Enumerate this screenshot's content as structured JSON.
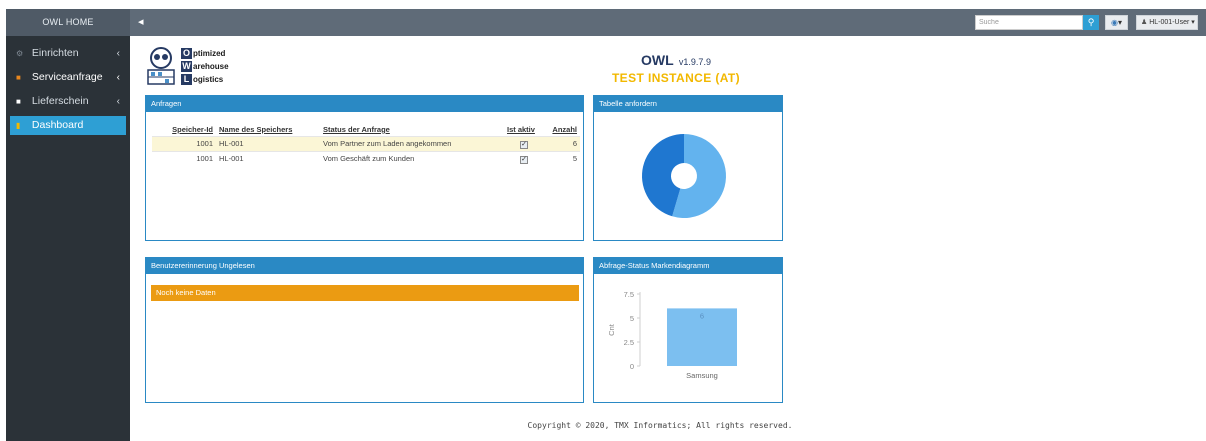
{
  "brand": "OWL HOME",
  "sidebar": {
    "items": [
      {
        "label": "Einrichten",
        "icon": "gear-icon"
      },
      {
        "label": "Serviceanfrage",
        "icon": "inbox-icon"
      },
      {
        "label": "Lieferschein",
        "icon": "file-icon"
      },
      {
        "label": "Dashboard",
        "icon": "bar-chart-icon"
      }
    ]
  },
  "topbar": {
    "search_placeholder": "Suche",
    "user_label": "HL-001-User"
  },
  "logo": {
    "lines": [
      {
        "letter": "O",
        "rest": "ptimized"
      },
      {
        "letter": "W",
        "rest": "arehouse"
      },
      {
        "letter": "L",
        "rest": "ogistics"
      }
    ]
  },
  "header": {
    "app_name": "OWL",
    "version": "v1.9.7.9",
    "instance": "TEST INSTANCE (AT)"
  },
  "requests": {
    "title": "Anfragen",
    "columns": [
      "Speicher-Id",
      "Name des Speichers",
      "Status der Anfrage",
      "Ist aktiv",
      "Anzahl"
    ],
    "rows": [
      {
        "id": "1001",
        "name": "HL-001",
        "status": "Vom Partner zum Laden angekommen",
        "active": true,
        "count": "6"
      },
      {
        "id": "1001",
        "name": "HL-001",
        "status": "Vom Geschäft zum Kunden",
        "active": true,
        "count": "5"
      }
    ]
  },
  "table_panel": {
    "title": "Tabelle anfordern"
  },
  "reminder": {
    "title": "Benutzererinnerung Ungelesen",
    "empty_text": "Noch keine Daten"
  },
  "status_panel": {
    "title": "Abfrage-Status Markendiagramm"
  },
  "colors": {
    "accent": "#2a89c4",
    "sidebar_bg": "#2b3238",
    "topbar_bg": "#5f6b78",
    "warning": "#eb9b12",
    "instance": "#f2b800",
    "donut_light": "#63b3ee",
    "donut_dark": "#1f77d0",
    "bar": "#7cbff0"
  },
  "chart_data": [
    {
      "type": "pie",
      "title": "",
      "labels": [
        "Vom Partner zum Laden angekommen",
        "Vom Geschäft zum Kunden"
      ],
      "values": [
        6,
        5
      ]
    },
    {
      "type": "bar",
      "title": "",
      "categories": [
        "Samsung"
      ],
      "values": [
        6
      ],
      "data_labels": [
        "6"
      ],
      "ylabel": "Cnt",
      "xlabel": "",
      "ylim": [
        0,
        7.5
      ],
      "yticks": [
        "0",
        "2.5",
        "5",
        "7.5"
      ],
      "grid": false
    }
  ],
  "copyright": "Copyright © 2020, TMX Informatics; All rights reserved."
}
